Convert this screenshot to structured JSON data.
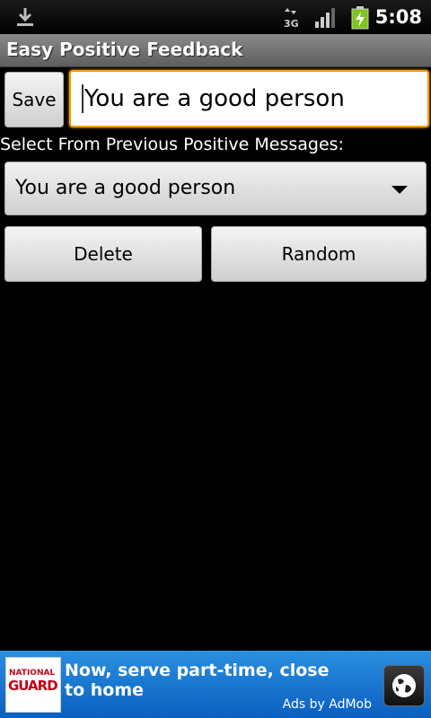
{
  "status_bar": {
    "time": "5:08",
    "network_label": "3G",
    "icons": [
      "download-icon",
      "network-3g-icon",
      "signal-icon",
      "battery-charging-icon"
    ]
  },
  "app": {
    "title": "Easy Positive Feedback"
  },
  "form": {
    "save_label": "Save",
    "message_value": "You are a good person",
    "select_label": "Select From Previous Positive Messages:",
    "selected_message": "You are a good person",
    "delete_label": "Delete",
    "random_label": "Random"
  },
  "ad": {
    "logo_top": "NATIONAL",
    "logo_bottom": "GUARD",
    "text": "Now, serve part-time, close to home",
    "attribution": "Ads by AdMob"
  },
  "colors": {
    "accent_focus": "#ff9a00",
    "ad_background": "#1a76d2",
    "titlebar": "#6f6f6f"
  }
}
